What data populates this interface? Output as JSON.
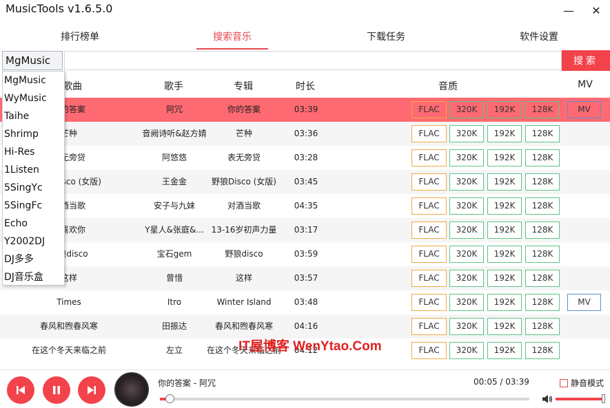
{
  "app": {
    "title": "MusicTools v1.6.5.0"
  },
  "window": {
    "minimize": "—",
    "close": "✕"
  },
  "tabs": [
    {
      "label": "排行榜单",
      "active": false
    },
    {
      "label": "搜索音乐",
      "active": true
    },
    {
      "label": "下载任务",
      "active": false
    },
    {
      "label": "软件设置",
      "active": false
    }
  ],
  "search": {
    "source": "MgMusic",
    "query": "",
    "button": "搜索"
  },
  "headers": {
    "song": "歌曲",
    "artist": "歌手",
    "album": "专辑",
    "duration": "时长",
    "quality": "音质",
    "mv": "MV"
  },
  "sources": [
    "MgMusic",
    "WyMusic",
    "Taihe",
    "Shrimp",
    "Hi-Res",
    "1Listen",
    "5SingYc",
    "5SingFc",
    "Echo",
    "Y2002DJ",
    "DJ多多",
    "DJ音乐盒"
  ],
  "rows": [
    {
      "song": "你的答案",
      "artist": "阿冗",
      "album": "你的答案",
      "duration": "03:39",
      "qualities": [
        "FLAC",
        "320K",
        "192K",
        "128K"
      ],
      "mv": "MV",
      "selected": true
    },
    {
      "song": "芒种",
      "artist": "音阙诗听&赵方婧",
      "album": "芒种",
      "duration": "03:36",
      "qualities": [
        "FLAC",
        "320K",
        "192K",
        "128K"
      ],
      "mv": ""
    },
    {
      "song": "表无旁贷",
      "artist": "阿悠悠",
      "album": "表无旁贷",
      "duration": "03:28",
      "qualities": [
        "FLAC",
        "320K",
        "192K",
        "128K"
      ],
      "mv": ""
    },
    {
      "song": "野狼Disco (女版)",
      "artist": "王金金",
      "album": "野狼Disco (女版)",
      "duration": "03:45",
      "qualities": [
        "FLAC",
        "320K",
        "192K",
        "128K"
      ],
      "mv": ""
    },
    {
      "song": "对酒当歌",
      "artist": "安子与九妹",
      "album": "对酒当歌",
      "duration": "04:35",
      "qualities": [
        "FLAC",
        "320K",
        "192K",
        "128K"
      ],
      "mv": ""
    },
    {
      "song": "我喜欢你",
      "artist": "Y星人&张庭&...",
      "album": "13-16岁初声力量",
      "duration": "03:17",
      "qualities": [
        "FLAC",
        "320K",
        "192K",
        "128K"
      ],
      "mv": ""
    },
    {
      "song": "野狼disco",
      "artist": "宝石gem",
      "album": "野狼disco",
      "duration": "03:59",
      "qualities": [
        "FLAC",
        "320K",
        "192K",
        "128K"
      ],
      "mv": ""
    },
    {
      "song": "这样",
      "artist": "曾惜",
      "album": "这样",
      "duration": "03:57",
      "qualities": [
        "FLAC",
        "320K",
        "192K",
        "128K"
      ],
      "mv": ""
    },
    {
      "song": "Times",
      "artist": "Itro",
      "album": "Winter Island",
      "duration": "03:48",
      "qualities": [
        "FLAC",
        "320K",
        "192K",
        "128K"
      ],
      "mv": "MV"
    },
    {
      "song": "春风和煦春风寒",
      "artist": "田振达",
      "album": "春风和煦春风寒",
      "duration": "04:16",
      "qualities": [
        "FLAC",
        "320K",
        "192K",
        "128K"
      ],
      "mv": ""
    },
    {
      "song": "在这个冬天来临之前",
      "artist": "左立",
      "album": "在这个冬天来临之前",
      "duration": "04:12",
      "qualities": [
        "FLAC",
        "320K",
        "192K",
        "128K"
      ],
      "mv": ""
    }
  ],
  "player": {
    "now_playing": "你的答案 - 阿冗",
    "time": "00:05 / 03:39",
    "progress": 0.02,
    "volume": 1.0,
    "mute_label": "静音模式",
    "mute_checked": false
  },
  "watermark": "IT屋博客 WenYtao.Com",
  "colors": {
    "accent": "#f2434b",
    "selected_row": "#ff6a72",
    "flac_border": "#f0a94a",
    "bitrate_border": "#58c48a",
    "mv_border": "#5b8fd4"
  }
}
